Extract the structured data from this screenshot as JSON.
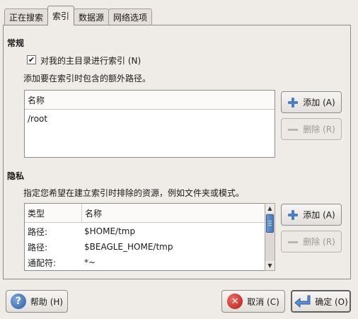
{
  "tabs": [
    "正在搜索",
    "索引",
    "数据源",
    "网络选项"
  ],
  "general": {
    "title": "常规",
    "checkbox_label": "对我的主目录进行索引 (N)",
    "checkbox_checked": "✔",
    "description": "添加要在索引时包含的额外路径。",
    "list_header": "名称",
    "paths": [
      "/root"
    ],
    "add_label": "添加 (A)",
    "remove_label": "删除 (R)"
  },
  "privacy": {
    "title": "隐私",
    "description": "指定您希望在建立索引时排除的资源，例如文件夹或模式。",
    "col_type": "类型",
    "col_name": "名称",
    "rows": [
      {
        "type": "路径:",
        "name": "$HOME/tmp"
      },
      {
        "type": "路径:",
        "name": "$BEAGLE_HOME/tmp"
      },
      {
        "type": "通配符:",
        "name": "*~"
      }
    ],
    "add_label": "添加 (A)",
    "remove_label": "删除 (R)"
  },
  "footer": {
    "help_label": "帮助 (H)",
    "cancel_label": "取消 (C)",
    "ok_label": "确定 (O)"
  },
  "icons": {
    "help": "?",
    "cancel": "✕",
    "scroll_up": "▲",
    "scroll_down": "▼"
  }
}
